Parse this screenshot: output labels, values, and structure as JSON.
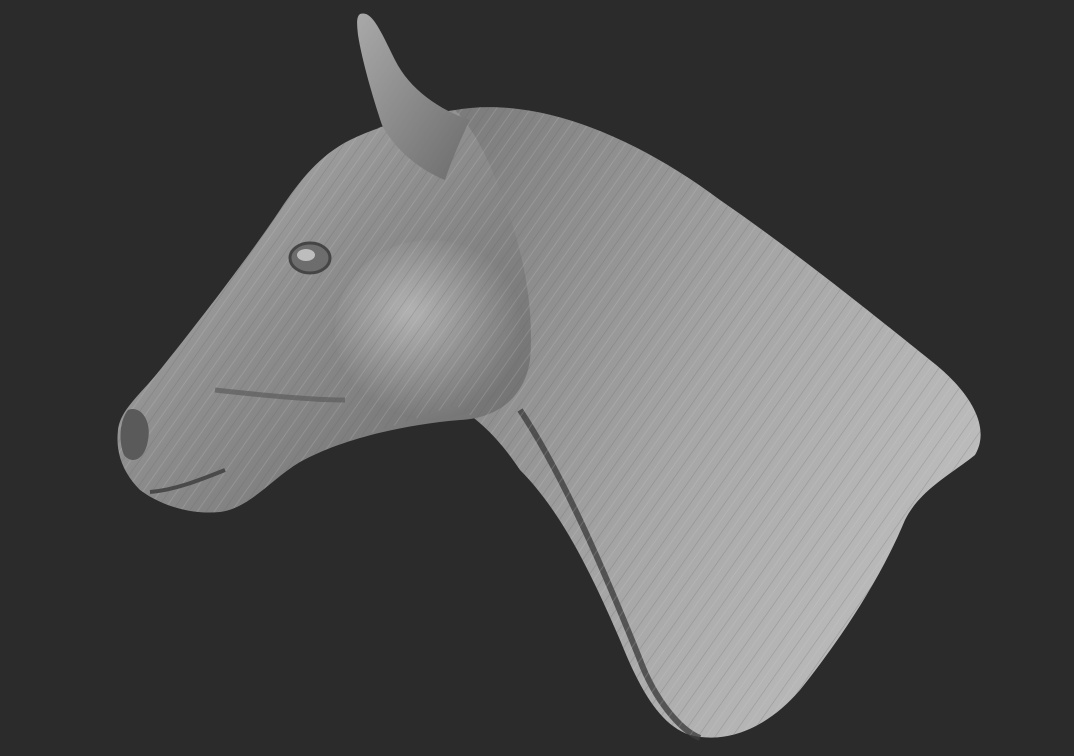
{
  "viewport": {
    "background_color": "#2b2b2b"
  },
  "model": {
    "subject": "horse-head-neck-sculpt",
    "base_color": "#8f8f8f",
    "highlight_color": "#c9c9c9",
    "shadow_color": "#3f3f3f"
  }
}
